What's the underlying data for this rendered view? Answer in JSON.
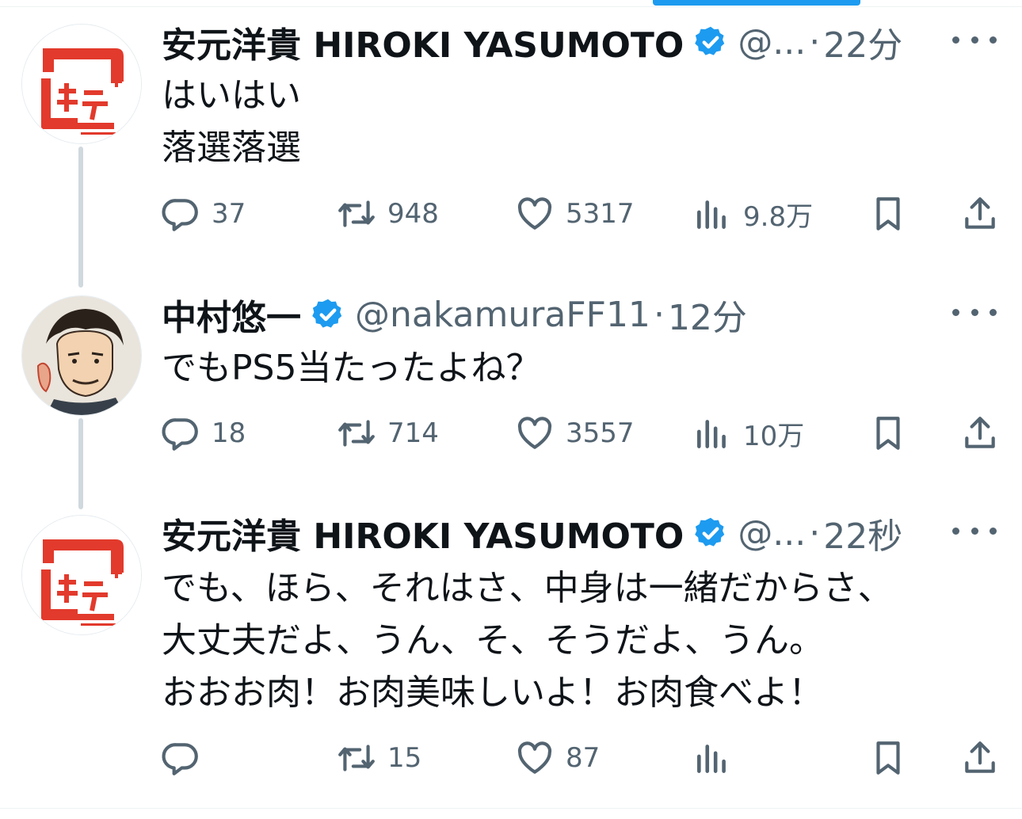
{
  "tweets": [
    {
      "name": "安元洋貴 HIROKI YASUMOTO",
      "handle": "@...",
      "time": "22分",
      "text": [
        "はいはい",
        "落選落選"
      ],
      "replies": "37",
      "retweets": "948",
      "likes": "5317",
      "views": "9.8万"
    },
    {
      "name": "中村悠一",
      "handle": "@nakamuraFF11",
      "time": "12分",
      "text": [
        "でもPS5当たったよね？"
      ],
      "replies": "18",
      "retweets": "714",
      "likes": "3557",
      "views": "10万"
    },
    {
      "name": "安元洋貴 HIROKI YASUMOTO",
      "handle": "@...",
      "time": "22秒",
      "text": [
        "でも、ほら、それはさ、中身は一緒だからさ、",
        "大丈夫だよ、うん、そ、そうだよ、うん。",
        "おおお肉！お肉美味しいよ！お肉食べよ！"
      ],
      "replies": "",
      "retweets": "15",
      "likes": "87",
      "views": ""
    }
  ],
  "separator": "·",
  "colors": {
    "accent": "#1d9bf0",
    "secondary_text": "#536471",
    "thread_line": "#cfd9de",
    "logo_red": "#e23a2c"
  },
  "icons": [
    "reply-icon",
    "retweet-icon",
    "like-icon",
    "views-icon",
    "bookmark-icon",
    "share-icon",
    "verified-badge-icon",
    "more-icon"
  ]
}
